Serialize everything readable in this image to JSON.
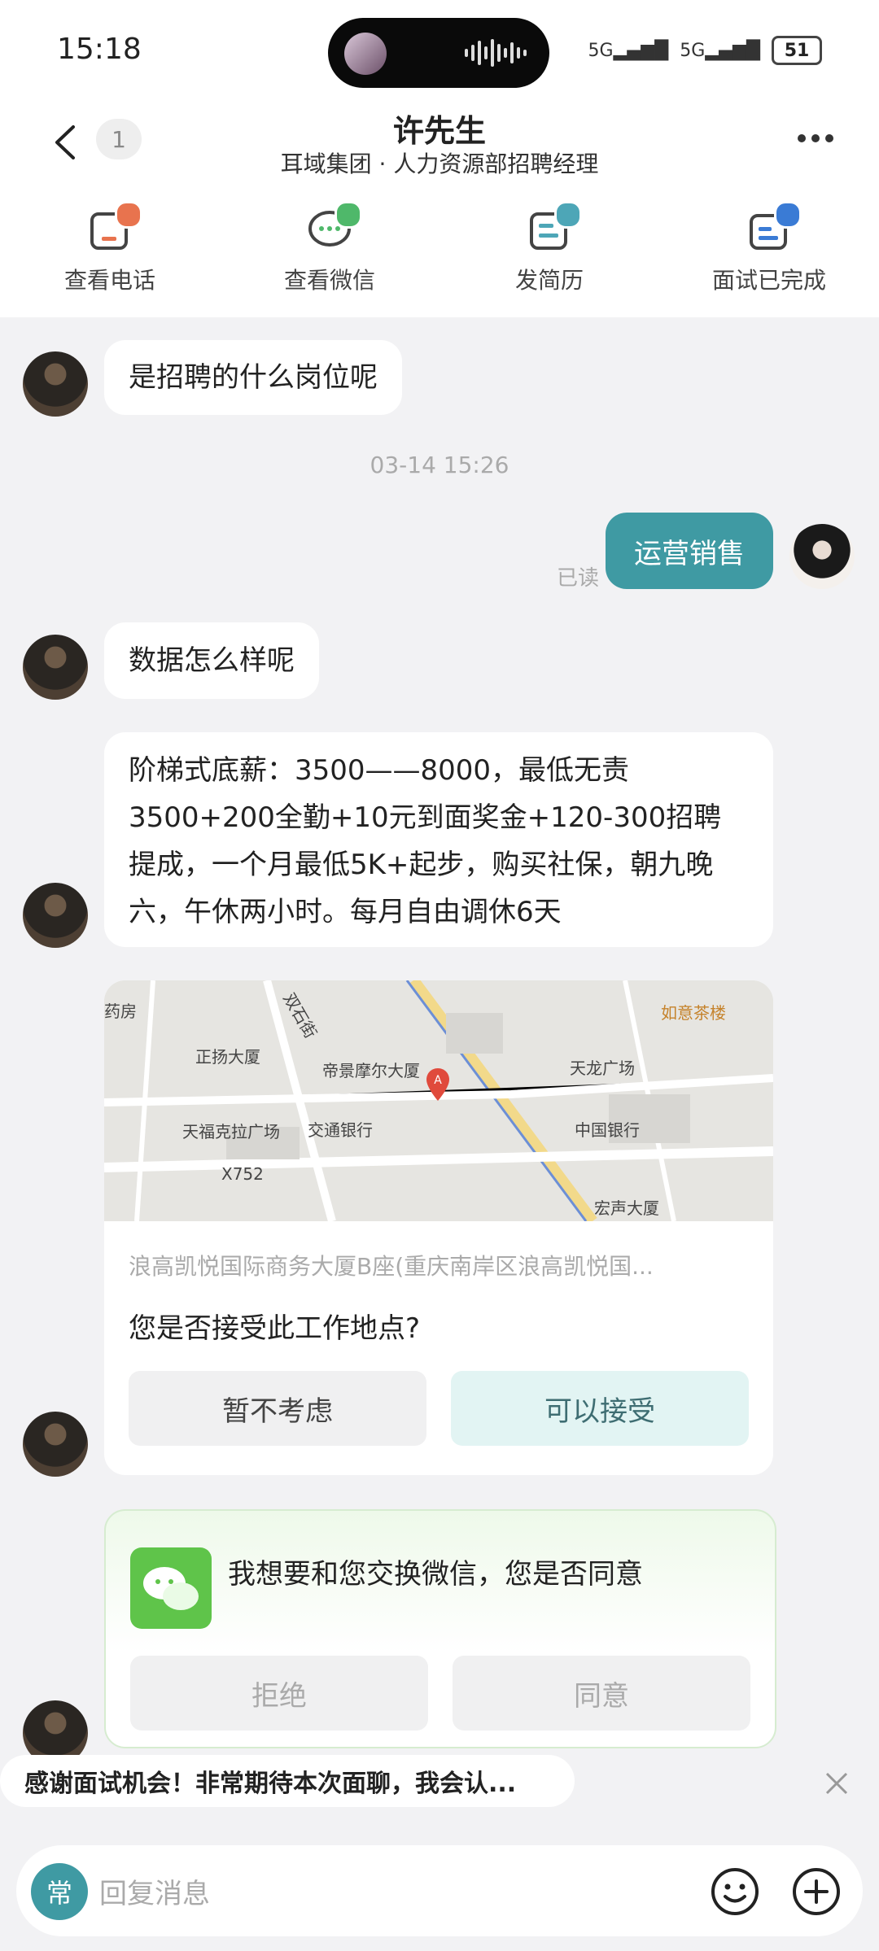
{
  "status": {
    "time": "15:18",
    "signal1": "5G",
    "signal2": "5G",
    "battery": "51"
  },
  "header": {
    "badge": "1",
    "name": "许先生",
    "subtitle": "耳域集团 · 人力资源部招聘经理"
  },
  "actions": [
    {
      "label": "查看电话",
      "icon": "phone-card-icon",
      "color": "#e8734e"
    },
    {
      "label": "查看微信",
      "icon": "wechat-chat-icon",
      "color": "#4fb86a"
    },
    {
      "label": "发简历",
      "icon": "resume-icon",
      "color": "#4da6b7"
    },
    {
      "label": "面试已完成",
      "icon": "interview-calendar-icon",
      "color": "#3a7bd5"
    }
  ],
  "messages": {
    "m1": "是招聘的什么岗位呢",
    "timestamp": "03-14 15:26",
    "me1": "运营销售",
    "read": "已读",
    "m2": "数据怎么样呢",
    "m3": "阶梯式底薪：3500——8000，最低无责3500+200全勤+10元到面奖金+120-300招聘提成，一个月最低5K+起步，购买社保，朝九晚六，午休两小时。每月自由调休6天"
  },
  "map_card": {
    "labels": [
      "药房",
      "正扬大厦",
      "帝景摩尔大厦",
      "天龙广场",
      "如意茶楼",
      "天福克拉广场",
      "交通银行",
      "中国银行",
      "宏声大厦",
      "X752",
      "双石街"
    ],
    "address": "浪高凯悦国际商务大厦B座(重庆南岸区浪高凯悦国...",
    "question": "您是否接受此工作地点?",
    "reject": "暂不考虑",
    "accept": "可以接受"
  },
  "wechat_card": {
    "text": "我想要和您交换微信，您是否同意",
    "reject": "拒绝",
    "agree": "同意"
  },
  "suggestion": "感谢面试机会！非常期待本次面聊，我会认...",
  "composer": {
    "chang": "常",
    "placeholder": "回复消息"
  }
}
